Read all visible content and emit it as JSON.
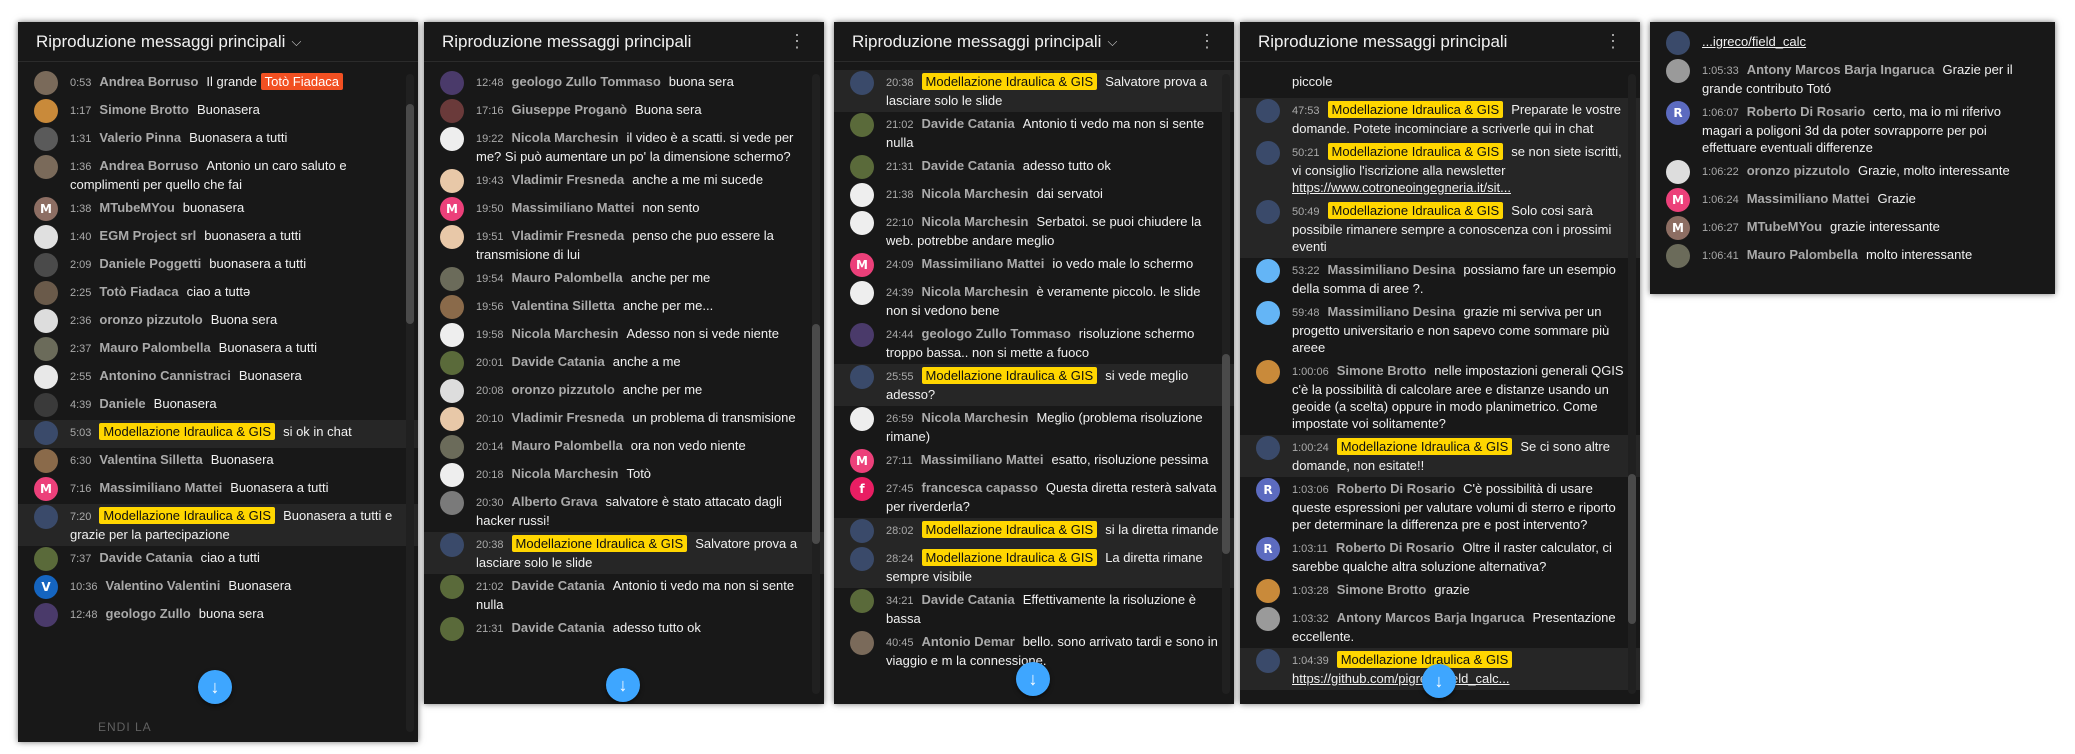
{
  "panels": [
    {
      "header": "Riproduzione messaggi principali",
      "footer": "ENDI LA",
      "messages": [
        {
          "t": "0:53",
          "a": "Andrea Borruso",
          "m": "Il grande",
          "mention": "Totò Fiadaca",
          "av": "#7a6a5a"
        },
        {
          "t": "1:17",
          "a": "Simone Brotto",
          "m": "Buonasera",
          "av": "#c98a3a"
        },
        {
          "t": "1:31",
          "a": "Valerio Pinna",
          "m": "Buonasera a tutti",
          "av": "#5a5a5a"
        },
        {
          "t": "1:36",
          "a": "Andrea Borruso",
          "m": "Antonio un caro saluto e complimenti per quello che fai",
          "av": "#7a6a5a"
        },
        {
          "t": "1:38",
          "a": "MTubeMYou",
          "m": "buonasera",
          "av": "#8d6e63",
          "ltr": "M"
        },
        {
          "t": "1:40",
          "a": "EGM Project srl",
          "m": "buonasera a tutti",
          "av": "#e0e0e0"
        },
        {
          "t": "2:09",
          "a": "Daniele Poggetti",
          "m": "buonasera a tutti",
          "av": "#4a4a4a"
        },
        {
          "t": "2:25",
          "a": "Totò Fiadaca",
          "m": "ciao a tuttə",
          "av": "#6a5a4a"
        },
        {
          "t": "2:36",
          "a": "oronzo pizzutolo",
          "m": "Buona sera",
          "av": "#dddddd"
        },
        {
          "t": "2:37",
          "a": "Mauro Palombella",
          "m": "Buonasera a tutti",
          "av": "#6b6b5a"
        },
        {
          "t": "2:55",
          "a": "Antonino Cannistraci",
          "m": "Buonasera",
          "av": "#e8e8e8"
        },
        {
          "t": "4:39",
          "a": "Daniele",
          "m": "Buonasera",
          "av": "#3a3a3a"
        },
        {
          "t": "5:03",
          "a": "Modellazione Idraulica & GIS",
          "m": "si ok in chat",
          "av": "#3a4a6a",
          "owner": true
        },
        {
          "t": "6:30",
          "a": "Valentina Silletta",
          "m": "Buonasera",
          "av": "#8a6a4a"
        },
        {
          "t": "7:16",
          "a": "Massimiliano Mattei",
          "m": "Buonasera a tutti",
          "av": "#ec407a",
          "ltr": "M"
        },
        {
          "t": "7:20",
          "a": "Modellazione Idraulica & GIS",
          "m": "Buonasera a tutti e grazie per la partecipazione",
          "av": "#3a4a6a",
          "owner": true
        },
        {
          "t": "7:37",
          "a": "Davide Catania",
          "m": "ciao a tutti",
          "av": "#5a6a3a"
        },
        {
          "t": "10:36",
          "a": "Valentino Valentini",
          "m": "Buonasera",
          "av": "#1565c0",
          "ltr": "V"
        },
        {
          "t": "12:48",
          "a": "geologo Zullo",
          "m": "buona sera",
          "av": "#4a3a6a"
        }
      ]
    },
    {
      "header": "Riproduzione messaggi principali",
      "messages": [
        {
          "t": "12:48",
          "a": "geologo Zullo Tommaso",
          "m": "buona sera",
          "av": "#4a3a6a"
        },
        {
          "t": "17:16",
          "a": "Giuseppe Proganò",
          "m": "Buona sera",
          "av": "#6a3a3a"
        },
        {
          "t": "19:22",
          "a": "Nicola Marchesin",
          "m": "il video è a scatti. si vede per me? Si può aumentare un po' la dimensione schermo?",
          "av": "#eeeeee"
        },
        {
          "t": "19:43",
          "a": "Vladimir Fresneda",
          "m": "anche a me mi sucede",
          "av": "#e8c8a8"
        },
        {
          "t": "19:50",
          "a": "Massimiliano Mattei",
          "m": "non sento",
          "av": "#ec407a",
          "ltr": "M"
        },
        {
          "t": "19:51",
          "a": "Vladimir Fresneda",
          "m": "penso che puo essere la transmisione di lui",
          "av": "#e8c8a8"
        },
        {
          "t": "19:54",
          "a": "Mauro Palombella",
          "m": "anche per me",
          "av": "#6b6b5a"
        },
        {
          "t": "19:56",
          "a": "Valentina Silletta",
          "m": "anche per me...",
          "av": "#8a6a4a"
        },
        {
          "t": "19:58",
          "a": "Nicola Marchesin",
          "m": "Adesso non si vede niente",
          "av": "#eeeeee"
        },
        {
          "t": "20:01",
          "a": "Davide Catania",
          "m": "anche a me",
          "av": "#5a6a3a"
        },
        {
          "t": "20:08",
          "a": "oronzo pizzutolo",
          "m": "anche per me",
          "av": "#dddddd"
        },
        {
          "t": "20:10",
          "a": "Vladimir Fresneda",
          "m": "un problema di transmisione",
          "av": "#e8c8a8"
        },
        {
          "t": "20:14",
          "a": "Mauro Palombella",
          "m": "ora non vedo niente",
          "av": "#6b6b5a"
        },
        {
          "t": "20:18",
          "a": "Nicola Marchesin",
          "m": "Totò",
          "av": "#eeeeee"
        },
        {
          "t": "20:30",
          "a": "Alberto Grava",
          "m": "salvatore è stato attacato dagli hacker russi!",
          "av": "#7a7a7a"
        },
        {
          "t": "20:38",
          "a": "Modellazione Idraulica & GIS",
          "m": "Salvatore prova a lasciare solo le slide",
          "av": "#3a4a6a",
          "owner": true
        },
        {
          "t": "21:02",
          "a": "Davide Catania",
          "m": "Antonio ti vedo ma non si sente nulla",
          "av": "#5a6a3a"
        },
        {
          "t": "21:31",
          "a": "Davide Catania",
          "m": "adesso tutto ok",
          "av": "#5a6a3a"
        }
      ]
    },
    {
      "header": "Riproduzione messaggi principali",
      "messages": [
        {
          "t": "20:38",
          "a": "Modellazione Idraulica & GIS",
          "m": "Salvatore prova a lasciare solo le slide",
          "av": "#3a4a6a",
          "owner": true
        },
        {
          "t": "21:02",
          "a": "Davide Catania",
          "m": "Antonio ti vedo ma non si sente nulla",
          "av": "#5a6a3a"
        },
        {
          "t": "21:31",
          "a": "Davide Catania",
          "m": "adesso tutto ok",
          "av": "#5a6a3a"
        },
        {
          "t": "21:38",
          "a": "Nicola Marchesin",
          "m": "dai servatoi",
          "av": "#eeeeee"
        },
        {
          "t": "22:10",
          "a": "Nicola Marchesin",
          "m": "Serbatoi. se puoi chiudere la web. potrebbe andare meglio",
          "av": "#eeeeee"
        },
        {
          "t": "24:09",
          "a": "Massimiliano Mattei",
          "m": "io vedo male lo schermo",
          "av": "#ec407a",
          "ltr": "M"
        },
        {
          "t": "24:39",
          "a": "Nicola Marchesin",
          "m": "è veramente piccolo. le slide non si vedono bene",
          "av": "#eeeeee"
        },
        {
          "t": "24:44",
          "a": "geologo Zullo Tommaso",
          "m": "risoluzione schermo troppo bassa.. non si mette a fuoco",
          "av": "#4a3a6a"
        },
        {
          "t": "25:55",
          "a": "Modellazione Idraulica & GIS",
          "m": "si vede meglio adesso?",
          "av": "#3a4a6a",
          "owner": true
        },
        {
          "t": "26:59",
          "a": "Nicola Marchesin",
          "m": "Meglio (problema risoluzione rimane)",
          "av": "#eeeeee"
        },
        {
          "t": "27:11",
          "a": "Massimiliano Mattei",
          "m": "esatto, risoluzione pessima",
          "av": "#ec407a",
          "ltr": "M"
        },
        {
          "t": "27:45",
          "a": "francesca capasso",
          "m": "Questa diretta resterà salvata per riverderla?",
          "av": "#e91e63",
          "ltr": "f"
        },
        {
          "t": "28:02",
          "a": "Modellazione Idraulica & GIS",
          "m": "si la diretta rimande",
          "av": "#3a4a6a",
          "owner": true
        },
        {
          "t": "28:24",
          "a": "Modellazione Idraulica & GIS",
          "m": "La diretta rimane sempre visibile",
          "av": "#3a4a6a",
          "owner": true
        },
        {
          "t": "34:21",
          "a": "Davide Catania",
          "m": "Effettivamente la risoluzione è bassa",
          "av": "#5a6a3a"
        },
        {
          "t": "40:45",
          "a": "Antonio Demar",
          "m": "bello. sono arrivato tardi e sono in viaggio e m la connessione.",
          "av": "#7a6a5a"
        }
      ]
    },
    {
      "header": "Riproduzione messaggi principali",
      "messages": [
        {
          "t": "",
          "a": "",
          "m": "piccole",
          "av": "",
          "cont": true
        },
        {
          "t": "47:53",
          "a": "Modellazione Idraulica & GIS",
          "m": "Preparate le vostre domande. Potete incominciare a scriverle qui in chat",
          "av": "#3a4a6a",
          "owner": true
        },
        {
          "t": "50:21",
          "a": "Modellazione Idraulica & GIS",
          "m": "se non siete iscritti, vi consiglio l'iscrizione alla newsletter",
          "link": "https://www.cotroneoingegneria.it/sit...",
          "av": "#3a4a6a",
          "owner": true
        },
        {
          "t": "50:49",
          "a": "Modellazione Idraulica & GIS",
          "m": "Solo cosi sarà possibile rimanere sempre a conoscenza con i prossimi eventi",
          "av": "#3a4a6a",
          "owner": true
        },
        {
          "t": "53:22",
          "a": "Massimiliano Desina",
          "m": "possiamo fare un esempio della somma di aree ?.",
          "av": "#64b5f6"
        },
        {
          "t": "59:48",
          "a": "Massimiliano Desina",
          "m": "grazie mi serviva per un progetto universitario e non sapevo come sommare più areee",
          "av": "#64b5f6"
        },
        {
          "t": "1:00:06",
          "a": "Simone Brotto",
          "m": "nelle impostazioni generali QGIS c'è la possibilità di calcolare aree e distanze usando un geoide (a scelta) oppure in modo planimetrico. Come impostate voi solitamente?",
          "av": "#c98a3a"
        },
        {
          "t": "1:00:24",
          "a": "Modellazione Idraulica & GIS",
          "m": "Se ci sono altre domande, non esitate!!",
          "av": "#3a4a6a",
          "owner": true
        },
        {
          "t": "1:03:06",
          "a": "Roberto Di Rosario",
          "m": "C'è possibilità di usare queste espressioni per valutare volumi di sterro e riporto per determinare la differenza pre e post intervento?",
          "av": "#5c6bc0",
          "ltr": "R"
        },
        {
          "t": "1:03:11",
          "a": "Roberto Di Rosario",
          "m": "Oltre il raster calculator, ci sarebbe qualche altra soluzione alternativa?",
          "av": "#5c6bc0",
          "ltr": "R"
        },
        {
          "t": "1:03:28",
          "a": "Simone Brotto",
          "m": "grazie",
          "av": "#c98a3a"
        },
        {
          "t": "1:03:32",
          "a": "Antony Marcos Barja Ingaruca",
          "m": "Presentazione eccellente.",
          "av": "#9a9a9a"
        },
        {
          "t": "1:04:39",
          "a": "Modellazione Idraulica & GIS",
          "m": "",
          "link": "https://github.com/pigreco/field_calc...",
          "av": "#3a4a6a",
          "owner": true
        }
      ]
    },
    {
      "header": "",
      "messages": [
        {
          "t": "",
          "a": "",
          "m": "",
          "link": "...igreco/field_calc",
          "av": "#3a4a6a",
          "cont": true
        },
        {
          "t": "1:05:33",
          "a": "Antony Marcos Barja Ingaruca",
          "m": "Grazie per il grande contributo Totó",
          "av": "#9a9a9a"
        },
        {
          "t": "1:06:07",
          "a": "Roberto Di Rosario",
          "m": "certo, ma io mi riferivo magari a poligoni 3d da poter sovrapporre per poi effettuare eventuali differenze",
          "av": "#5c6bc0",
          "ltr": "R"
        },
        {
          "t": "1:06:22",
          "a": "oronzo pizzutolo",
          "m": "Grazie, molto interessante",
          "av": "#dddddd"
        },
        {
          "t": "1:06:24",
          "a": "Massimiliano Mattei",
          "m": "Grazie",
          "av": "#ec407a",
          "ltr": "M"
        },
        {
          "t": "1:06:27",
          "a": "MTubeMYou",
          "m": "grazie interessante",
          "av": "#8d6e63",
          "ltr": "M"
        },
        {
          "t": "1:06:41",
          "a": "Mauro Palombella",
          "m": "molto interessante",
          "av": "#6b6b5a"
        }
      ]
    }
  ]
}
